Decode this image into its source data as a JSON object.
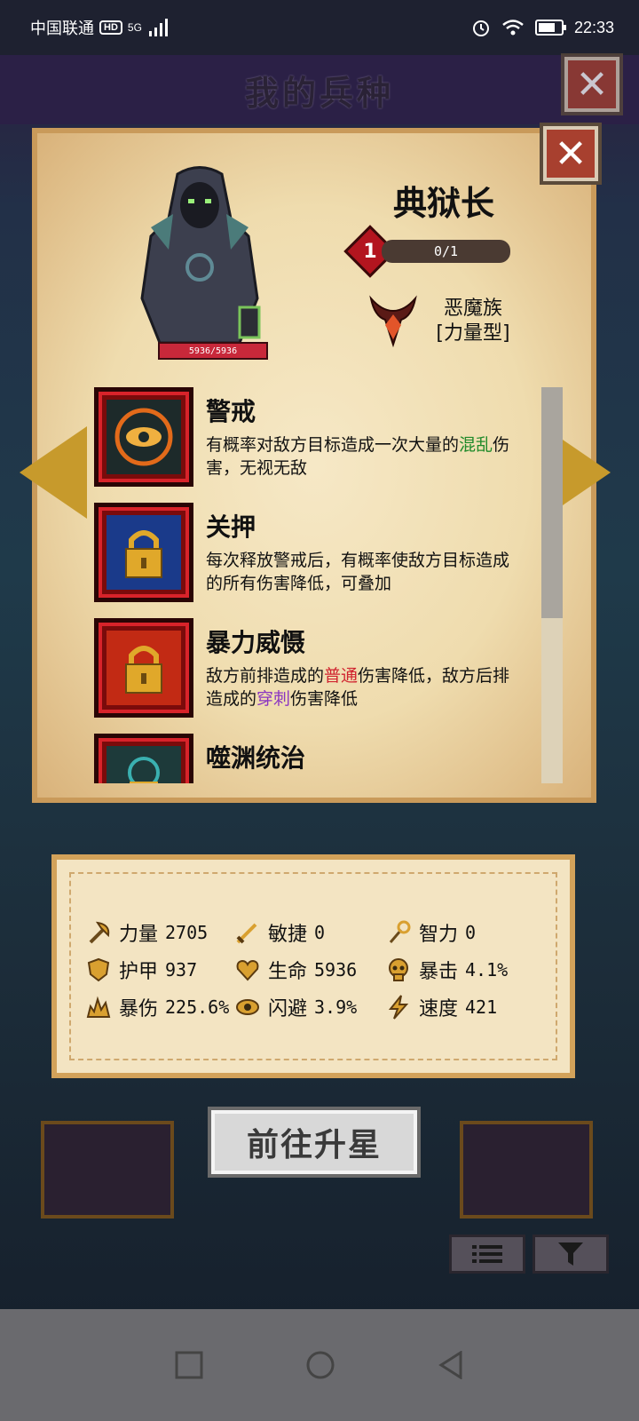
{
  "status": {
    "carrier": "中国联通",
    "hd": "HD",
    "network": "5G",
    "time": "22:33"
  },
  "header": {
    "title": "我的兵种"
  },
  "unit": {
    "name": "典狱长",
    "hp": "5936/5936",
    "level": "1",
    "stars": "0/1",
    "race": "恶魔族",
    "type": "[力量型]"
  },
  "skills": [
    {
      "name": "警戒",
      "desc_parts": [
        {
          "t": "有概率对敌方目标造成一次大量的"
        },
        {
          "t": "混乱",
          "c": "green"
        },
        {
          "t": "伤害，无视无敌"
        }
      ]
    },
    {
      "name": "关押",
      "desc_parts": [
        {
          "t": "每次释放警戒后，有概率使敌方目标造成的所有伤害降低，可叠加"
        }
      ]
    },
    {
      "name": "暴力威慑",
      "desc_parts": [
        {
          "t": "敌方前排造成的"
        },
        {
          "t": "普通",
          "c": "red"
        },
        {
          "t": "伤害降低，敌方后排造成的"
        },
        {
          "t": "穿刺",
          "c": "purple"
        },
        {
          "t": "伤害降低"
        }
      ]
    },
    {
      "name": "噬渊统治",
      "desc_parts": []
    }
  ],
  "stats": [
    {
      "label": "力量",
      "value": "2705",
      "icon": "axe-icon"
    },
    {
      "label": "敏捷",
      "value": "0",
      "icon": "sword-icon"
    },
    {
      "label": "智力",
      "value": "0",
      "icon": "staff-icon"
    },
    {
      "label": "护甲",
      "value": "937",
      "icon": "shield-icon"
    },
    {
      "label": "生命",
      "value": "5936",
      "icon": "heart-icon"
    },
    {
      "label": "暴击",
      "value": "4.1%",
      "icon": "skull-icon"
    },
    {
      "label": "暴伤",
      "value": "225.6%",
      "icon": "burst-icon"
    },
    {
      "label": "闪避",
      "value": "3.9%",
      "icon": "eye-icon"
    },
    {
      "label": "速度",
      "value": "421",
      "icon": "lightning-icon"
    }
  ],
  "actions": {
    "upgrade": "前往升星"
  },
  "colors": {
    "parchment": "#efdcae",
    "accent_red": "#b3151f",
    "gold": "#c79a2c",
    "keyword_green": "#1f8a2a",
    "keyword_red": "#d0232f",
    "keyword_purple": "#8a34c2"
  }
}
